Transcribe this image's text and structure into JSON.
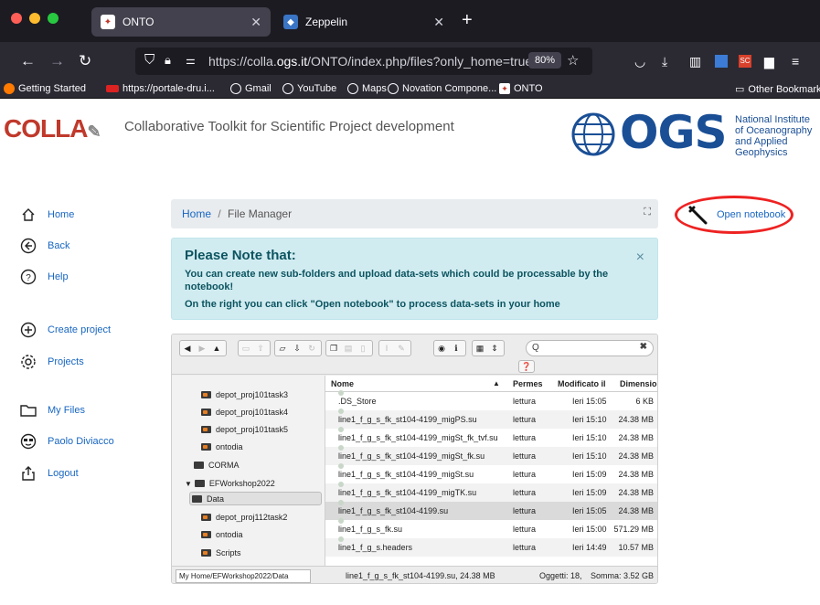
{
  "browser": {
    "tabs": [
      {
        "title": "ONTO",
        "active": true
      },
      {
        "title": "Zeppelin",
        "active": false
      }
    ],
    "url_prefix": "https://colla.",
    "url_domain": "ogs.it",
    "url_suffix": "/ONTO/index.php/files?only_home=true",
    "zoom": "80%",
    "bookmarks": [
      "Getting Started",
      "https://portale-dru.i...",
      "Gmail",
      "YouTube",
      "Maps",
      "Novation Compone...",
      "ONTO"
    ],
    "other_bookmarks": "Other Bookmarks"
  },
  "header": {
    "logo": "COLLA",
    "subtitle": "Collaborative Toolkit for Scientific Project development",
    "ogs": "OGS",
    "ogs_institute": [
      "National Institute",
      "of Oceanography",
      "and Applied",
      "Geophysics"
    ]
  },
  "sidebar": {
    "items": [
      {
        "label": "Home",
        "icon": "home-icon"
      },
      {
        "label": "Back",
        "icon": "back-icon"
      },
      {
        "label": "Help",
        "icon": "help-icon"
      },
      {
        "label": "Create project",
        "icon": "plus-circle-icon"
      },
      {
        "label": "Projects",
        "icon": "gear-icon"
      },
      {
        "label": "My Files",
        "icon": "folder-icon"
      },
      {
        "label": "Paolo Diviacco",
        "icon": "user-icon"
      },
      {
        "label": "Logout",
        "icon": "logout-icon"
      }
    ]
  },
  "breadcrumb": {
    "home": "Home",
    "separator": "/",
    "current": "File Manager"
  },
  "open_notebook": "Open notebook",
  "alert": {
    "title": "Please Note that:",
    "line1": "You can create new sub-folders and upload data-sets which could be processable by the notebook!",
    "line2": "On the right you can click \"Open notebook\" to process data-sets in your home",
    "close": "×"
  },
  "filemanager": {
    "search_placeholder": "",
    "tree": [
      {
        "label": "depot_proj101task3",
        "type": "project",
        "indent": 1
      },
      {
        "label": "depot_proj101task4",
        "type": "project",
        "indent": 1
      },
      {
        "label": "depot_proj101task5",
        "type": "project",
        "indent": 1
      },
      {
        "label": "ontodia",
        "type": "project",
        "indent": 1
      },
      {
        "label": "CORMA",
        "type": "folder",
        "indent": 0
      },
      {
        "label": "EFWorkshop2022",
        "type": "folder-open",
        "indent": 0
      },
      {
        "label": "Data",
        "type": "folder-open",
        "indent": 1,
        "selected": true
      },
      {
        "label": "depot_proj112task2",
        "type": "project",
        "indent": 1
      },
      {
        "label": "ontodia",
        "type": "project",
        "indent": 1
      },
      {
        "label": "Scripts",
        "type": "project",
        "indent": 1
      }
    ],
    "columns": {
      "name": "Nome",
      "sort": "▲",
      "perm": "Permes",
      "modified": "Modificato il",
      "size": "Dimensioni"
    },
    "rows": [
      {
        "name": ".DS_Store",
        "perm": "lettura",
        "modified": "Ieri 15:05",
        "size": "6 KB"
      },
      {
        "name": "line1_f_g_s_fk_st104-4199_migPS.su",
        "perm": "lettura",
        "modified": "Ieri 15:10",
        "size": "24.38 MB"
      },
      {
        "name": "line1_f_g_s_fk_st104-4199_migSt_fk_tvf.su",
        "perm": "lettura",
        "modified": "Ieri 15:10",
        "size": "24.38 MB"
      },
      {
        "name": "line1_f_g_s_fk_st104-4199_migSt_fk.su",
        "perm": "lettura",
        "modified": "Ieri 15:10",
        "size": "24.38 MB"
      },
      {
        "name": "line1_f_g_s_fk_st104-4199_migSt.su",
        "perm": "lettura",
        "modified": "Ieri 15:09",
        "size": "24.38 MB"
      },
      {
        "name": "line1_f_g_s_fk_st104-4199_migTK.su",
        "perm": "lettura",
        "modified": "Ieri 15:09",
        "size": "24.38 MB"
      },
      {
        "name": "line1_f_g_s_fk_st104-4199.su",
        "perm": "lettura",
        "modified": "Ieri 15:05",
        "size": "24.38 MB"
      },
      {
        "name": "line1_f_g_s_fk.su",
        "perm": "lettura",
        "modified": "Ieri 15:00",
        "size": "571.29 MB"
      },
      {
        "name": "line1_f_g_s.headers",
        "perm": "lettura",
        "modified": "Ieri 14:49",
        "size": "10.57 MB"
      }
    ],
    "status_path": "My Home/EFWorkshop2022/Data",
    "status_selected": "line1_f_g_s_fk_st104-4199.su, 24.38 MB",
    "status_objects": "Oggetti: 18,",
    "status_total": "Somma: 3.52 GB"
  }
}
